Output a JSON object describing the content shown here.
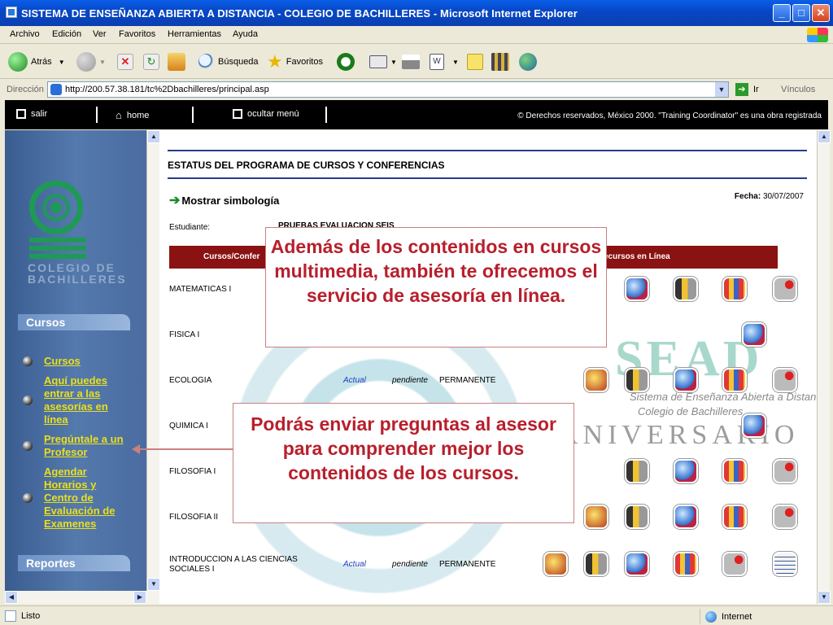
{
  "window": {
    "title": "SISTEMA DE ENSEÑANZA ABIERTA A DISTANCIA - COLEGIO DE BACHILLERES - Microsoft Internet Explorer",
    "min_symbol": "_",
    "max_symbol": "□",
    "close_symbol": "✕"
  },
  "menu": [
    "Archivo",
    "Edición",
    "Ver",
    "Favoritos",
    "Herramientas",
    "Ayuda"
  ],
  "toolbar": {
    "back": "Atrás",
    "search": "Búsqueda",
    "favorites": "Favoritos"
  },
  "address": {
    "label": "Dirección",
    "url": "http://200.57.38.181/tc%2Dbachilleres/principal.asp",
    "go": "Ir",
    "links": "Vínculos"
  },
  "sitebar": {
    "salir": "salir",
    "home": "home",
    "ocultar": "ocultar menú",
    "copyright": "© Derechos reservados, México 2000. \"Training Coordinator\" es una obra registrada"
  },
  "sidebar": {
    "logo_text": "COLEGIO DE\nBACHILLERES",
    "section_cursos": "Cursos",
    "items": [
      {
        "label": "Cursos"
      },
      {
        "label": "Aquí puedes entrar a las asesorías en línea"
      },
      {
        "label": "Pregúntale a un Profesor"
      },
      {
        "label": "Agendar Horarios y Centro de Evaluación de Examenes"
      }
    ],
    "section_reportes": "Reportes"
  },
  "content": {
    "title": "ESTATUS DEL PROGRAMA DE CURSOS Y CONFERENCIAS",
    "show_symbols": "Mostrar simbología",
    "fecha_label": "Fecha:",
    "fecha_value": "30/07/2007",
    "student_label": "Estudiante:",
    "student_value": "PRUEBAS EVALUACION SEIS",
    "table_header_left": "Cursos/Confer",
    "table_header_right": "ecursos en Línea",
    "watermark_title": "SEAD",
    "watermark_line1": "Sistema de Enseñanza Abierta a Distancia",
    "watermark_line2": "Colegio de Bachilleres",
    "watermark_aniv": "ANIVERSARIO",
    "rows": [
      {
        "name": "MATEMATICAS I",
        "status": "",
        "state": "",
        "perm": "",
        "icons": [
          "c",
          "b",
          "d",
          "e"
        ]
      },
      {
        "name": "FISICA I",
        "status": "",
        "state": "",
        "perm": "",
        "icons": [
          "c"
        ]
      },
      {
        "name": "ECOLOGIA",
        "status": "Actual",
        "state": "pendiente",
        "perm": "PERMANENTE",
        "icons": [
          "a",
          "b",
          "c",
          "d",
          "e"
        ]
      },
      {
        "name": "QUIMICA I",
        "status": "",
        "state": "",
        "perm": "",
        "icons": [
          "c"
        ]
      },
      {
        "name": "FILOSOFIA I",
        "status": "",
        "state": "",
        "perm": "",
        "icons": [
          "b",
          "c",
          "d",
          "e"
        ]
      },
      {
        "name": "FILOSOFIA II",
        "status": "",
        "state": "",
        "perm": "",
        "icons": [
          "a",
          "b",
          "c",
          "d",
          "e"
        ]
      },
      {
        "name": "INTRODUCCION A LAS CIENCIAS SOCIALES I",
        "status": "Actual",
        "state": "pendiente",
        "perm": "PERMANENTE",
        "icons": [
          "a",
          "b",
          "c",
          "d",
          "e",
          "f"
        ]
      }
    ]
  },
  "callouts": {
    "first": "Además de los contenidos en cursos multimedia, también te ofrecemos el servicio de asesoría en línea.",
    "second": "Podrás enviar preguntas al asesor para comprender mejor los contenidos de los cursos."
  },
  "statusbar": {
    "text": "Listo",
    "zone": "Internet"
  }
}
